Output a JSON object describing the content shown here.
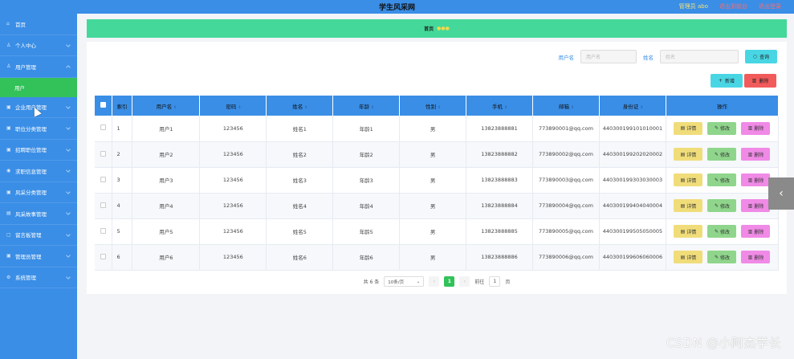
{
  "header": {
    "title": "学生风采网",
    "admin": "管理员 abo",
    "link_front": "退出到前台",
    "link_logout": "退出登录"
  },
  "sidebar": {
    "items": [
      {
        "label": "首页",
        "icon": "home-icon"
      },
      {
        "label": "个人中心",
        "icon": "user-icon"
      },
      {
        "label": "用户管理",
        "icon": "users-icon"
      },
      {
        "label": "用户",
        "icon": "",
        "sub": true
      },
      {
        "label": "企业用户管理",
        "icon": "building-icon"
      },
      {
        "label": "职位分类管理",
        "icon": "tag-icon"
      },
      {
        "label": "招聘职位管理",
        "icon": "briefcase-icon"
      },
      {
        "label": "求职信息管理",
        "icon": "document-icon"
      },
      {
        "label": "风采分类管理",
        "icon": "folder-icon"
      },
      {
        "label": "风采故事管理",
        "icon": "book-icon"
      },
      {
        "label": "留言板管理",
        "icon": "message-icon"
      },
      {
        "label": "管理员管理",
        "icon": "shield-icon"
      },
      {
        "label": "系统管理",
        "icon": "gear-icon"
      }
    ]
  },
  "breadcrumb": {
    "home": "首页",
    "dots": "●●●"
  },
  "search": {
    "username_label": "用户名",
    "username_placeholder": "用户名",
    "name_label": "姓名",
    "name_placeholder": "姓名",
    "search_button": "查询"
  },
  "actions": {
    "add": "新增",
    "delete": "删除"
  },
  "table": {
    "columns": [
      "索引",
      "用户名",
      "密码",
      "姓名",
      "年龄",
      "性别",
      "手机",
      "邮箱",
      "身份证",
      "操作"
    ],
    "rows": [
      {
        "index": "1",
        "username": "用户1",
        "password": "123456",
        "name": "姓名1",
        "age": "年龄1",
        "gender": "男",
        "phone": "13823888881",
        "email": "773890001@qq.com",
        "idcard": "440300199101010001"
      },
      {
        "index": "2",
        "username": "用户2",
        "password": "123456",
        "name": "姓名2",
        "age": "年龄2",
        "gender": "男",
        "phone": "13823888882",
        "email": "773890002@qq.com",
        "idcard": "440300199202020002"
      },
      {
        "index": "3",
        "username": "用户3",
        "password": "123456",
        "name": "姓名3",
        "age": "年龄3",
        "gender": "男",
        "phone": "13823888883",
        "email": "773890003@qq.com",
        "idcard": "440300199303030003"
      },
      {
        "index": "4",
        "username": "用户4",
        "password": "123456",
        "name": "姓名4",
        "age": "年龄4",
        "gender": "男",
        "phone": "13823888884",
        "email": "773890004@qq.com",
        "idcard": "440300199404040004"
      },
      {
        "index": "5",
        "username": "用户5",
        "password": "123456",
        "name": "姓名5",
        "age": "年龄5",
        "gender": "男",
        "phone": "13823888885",
        "email": "773890005@qq.com",
        "idcard": "440300199505050005"
      },
      {
        "index": "6",
        "username": "用户6",
        "password": "123456",
        "name": "姓名6",
        "age": "年龄6",
        "gender": "男",
        "phone": "13823888886",
        "email": "773890006@qq.com",
        "idcard": "440300199606060006"
      }
    ],
    "op_detail": "详情",
    "op_edit": "修改",
    "op_delete": "删除"
  },
  "pagination": {
    "total": "共 6 条",
    "page_size": "10条/页",
    "current_page": "1",
    "goto_label": "前往",
    "goto_value": "1",
    "page_suffix": "页"
  },
  "watermark": "CSDN @小阿杰学长",
  "colors": {
    "primary": "#3a8ee6",
    "accent_green": "#33c15a",
    "breadcrumb_bg": "#44d89a"
  }
}
